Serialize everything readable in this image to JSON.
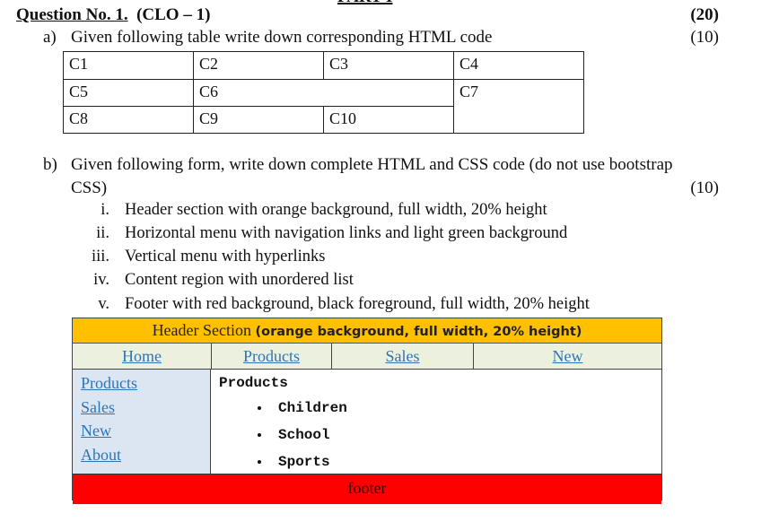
{
  "part_title": "PART I",
  "question": {
    "title": "Question No. 1.",
    "clo": "(CLO – 1)",
    "total_marks": "(20)"
  },
  "part_a": {
    "label": "a)",
    "text": "Given following table write down corresponding HTML code",
    "marks": "(10)",
    "table": {
      "rows": [
        [
          "C1",
          "C2",
          "C3",
          "C4"
        ],
        [
          "C5",
          "C6",
          "C7"
        ],
        [
          "C8",
          "C9",
          "C10"
        ]
      ]
    }
  },
  "part_b": {
    "label": "b)",
    "text_line1": "Given following form, write down complete HTML and CSS code (do not use bootstrap",
    "text_line2": "CSS)",
    "marks": "(10)",
    "requirements": [
      {
        "num": "i.",
        "text": "Header section with orange background, full width, 20% height"
      },
      {
        "num": "ii.",
        "text": "Horizontal menu with navigation links and light green background"
      },
      {
        "num": "iii.",
        "text": "Vertical menu with hyperlinks"
      },
      {
        "num": "iv.",
        "text": "Content region with unordered list"
      },
      {
        "num": "v.",
        "text": "Footer with red background, black foreground, full width, 20% height"
      }
    ]
  },
  "mockup": {
    "header_text": "Header Section ",
    "header_bold": "(orange background, full width, 20% height)",
    "nav": [
      "Home",
      "Products",
      "Sales",
      "New"
    ],
    "sidebar": [
      "Products",
      "Sales",
      "New",
      "About"
    ],
    "content_title": "Products",
    "content_list": [
      "Children",
      "School",
      "Sports"
    ],
    "footer": "footer",
    "colors": {
      "header_bg": "#ffc000",
      "nav_bg": "#ebf1de",
      "sidebar_bg": "#dce6f2",
      "footer_bg": "#ff0000",
      "link": "#2e74b5"
    }
  }
}
